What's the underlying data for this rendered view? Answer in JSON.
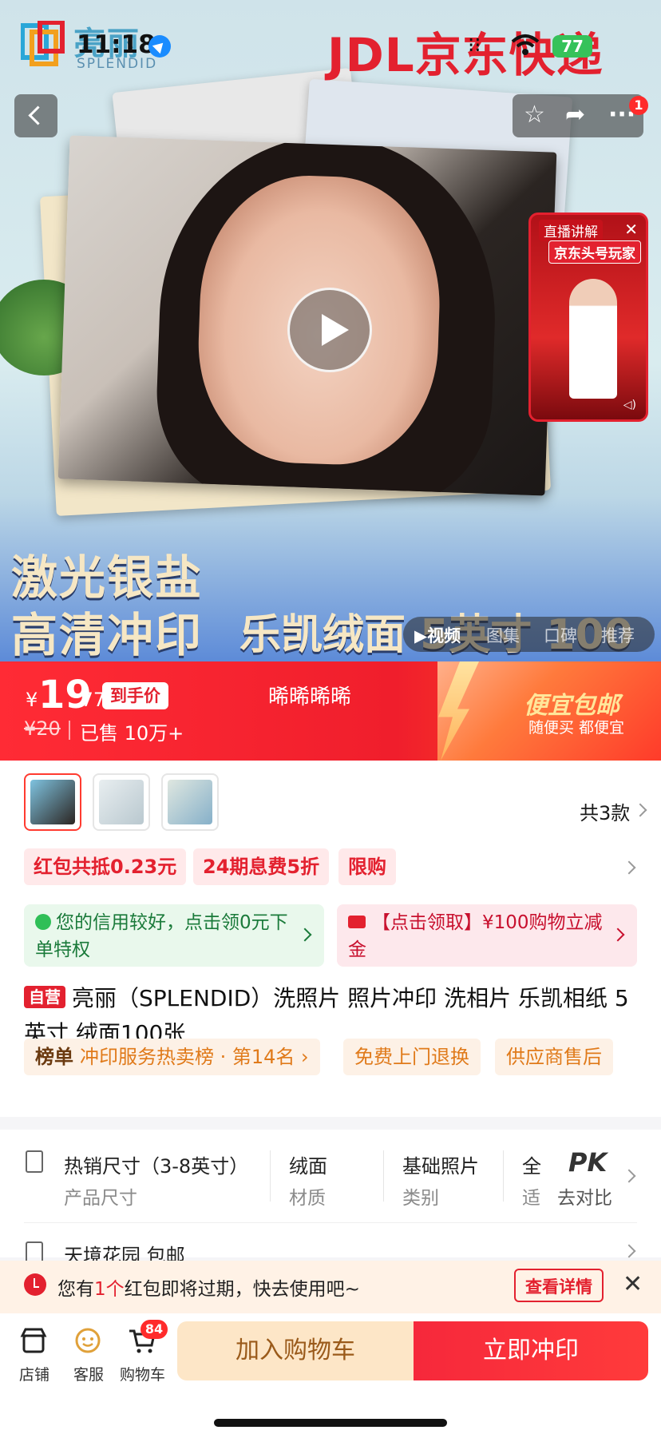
{
  "status_bar": {
    "time": "11:18",
    "battery": "77"
  },
  "brand": {
    "logo_text": "亮丽",
    "logo_sub": "SPLENDID",
    "carrier_banner": "JDL京东快递"
  },
  "nav": {
    "badge_count": "1"
  },
  "live": {
    "label": "直播讲解",
    "channel": "京东头号玩家"
  },
  "hero": {
    "line1": "激光银盐",
    "line2": "高清冲印",
    "line3": "乐凯绒面 5英寸 100张",
    "media_tabs": [
      {
        "label": "▶视频",
        "active": true
      },
      {
        "label": "图集",
        "active": false
      },
      {
        "label": "口碑",
        "active": false
      },
      {
        "label": "推荐",
        "active": false
      }
    ]
  },
  "price": {
    "currency": "¥",
    "integer": "19",
    "decimal": ".77",
    "hand_price_label": "到手价",
    "original": "¥20",
    "sold": "已售 10万+",
    "middle_text": "晞晞晞晞",
    "promo_title": "便宜包邮",
    "promo_sub": "随便买 都便宜"
  },
  "variants": {
    "total": "共3款"
  },
  "promos": [
    "红包共抵0.23元",
    "24期息费5折",
    "限购"
  ],
  "credit_box": {
    "text": "您的信用较好，点击领0元下单特权"
  },
  "coupon_box": {
    "text": "【点击领取】¥100购物立减金"
  },
  "product": {
    "self_run": "自营",
    "title": "亮丽（SPLENDID）洗照片 照片冲印 洗相片 乐凯相纸 5英寸 绒面100张"
  },
  "tags": {
    "rank_bold": "榜单",
    "rank_text": "冲印服务热卖榜 · 第14名 ›",
    "return": "免费上门退换",
    "aftersale": "供应商售后"
  },
  "specs": [
    {
      "value": "热销尺寸（3-8英寸）",
      "label": "产品尺寸"
    },
    {
      "value": "绒面",
      "label": "材质"
    },
    {
      "value": "基础照片",
      "label": "类别"
    },
    {
      "value": "全",
      "label": "适"
    }
  ],
  "compare": {
    "pk": "PK",
    "label": "去对比"
  },
  "delivery": {
    "text": "天境花园 包邮"
  },
  "toast": {
    "prefix": "您有",
    "count": "1个",
    "suffix": "红包即将过期，快去使用吧~",
    "button": "查看详情"
  },
  "bottom": {
    "shop": "店铺",
    "service": "客服",
    "cart": "购物车",
    "cart_badge": "84",
    "add_cart": "加入购物车",
    "buy_now": "立即冲印"
  }
}
